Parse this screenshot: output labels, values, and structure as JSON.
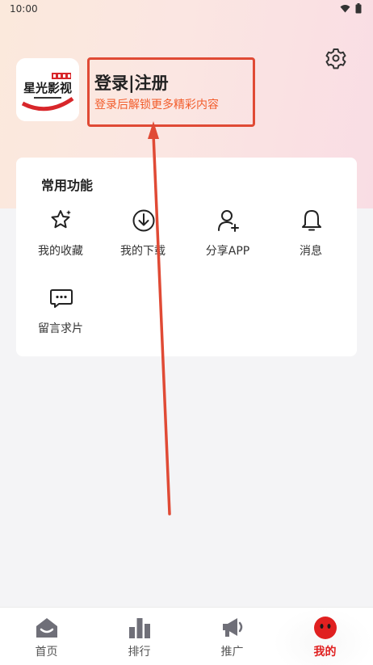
{
  "status_bar": {
    "time": "10:00"
  },
  "profile": {
    "title": "登录|注册",
    "subtitle": "登录后解锁更多精彩内容",
    "logo_text": "星光影视"
  },
  "functions": {
    "title": "常用功能",
    "items": [
      {
        "label": "我的收藏",
        "icon": "star-icon"
      },
      {
        "label": "我的下载",
        "icon": "download-icon"
      },
      {
        "label": "分享APP",
        "icon": "user-add-icon"
      },
      {
        "label": "消息",
        "icon": "bell-icon"
      },
      {
        "label": "留言求片",
        "icon": "chat-icon"
      }
    ]
  },
  "nav": {
    "items": [
      {
        "label": "首页",
        "icon": "home-icon"
      },
      {
        "label": "排行",
        "icon": "bar-chart-icon"
      },
      {
        "label": "推广",
        "icon": "megaphone-icon"
      },
      {
        "label": "我的",
        "icon": "profile-face-icon"
      }
    ],
    "active_index": 3
  },
  "colors": {
    "accent": "#e02020",
    "subtitle": "#f25c2b",
    "annotation": "#e04a35"
  }
}
